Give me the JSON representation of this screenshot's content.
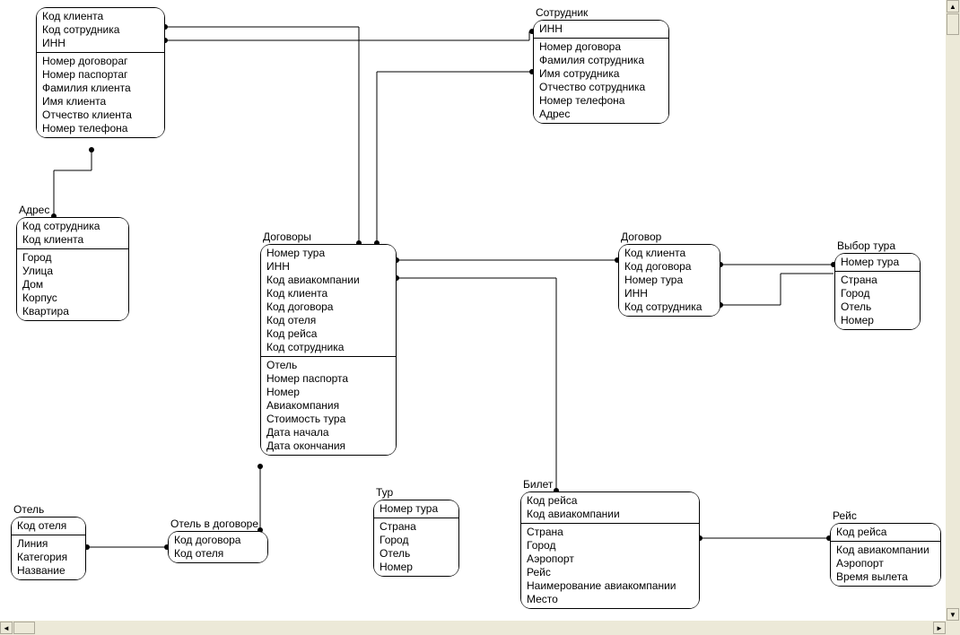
{
  "entities": {
    "client": {
      "title": "",
      "keys": [
        "Код клиента",
        "Код сотрудника",
        "ИНН"
      ],
      "fields": [
        "Номер договораг",
        "Номер паспортаг",
        "Фамилия клиента",
        "Имя клиента",
        "Отчество клиента",
        "Номер телефона"
      ]
    },
    "employee": {
      "title": "Сотрудник",
      "keys": [
        "ИНН"
      ],
      "fields": [
        "Номер договора",
        "Фамилия сотрудника",
        "Имя сотрудника",
        "Отчество сотрудника",
        "Номер телефона",
        "Адрес"
      ]
    },
    "address": {
      "title": "Адрес",
      "keys": [
        "Код сотрудника",
        "Код клиента"
      ],
      "fields": [
        "Город",
        "Улица",
        "Дом",
        "Корпус",
        "Квартира"
      ]
    },
    "contracts": {
      "title": "Договоры",
      "keys": [
        "Номер тура",
        "ИНН",
        "Код авиакомпании",
        "Код клиента",
        "Код договора",
        "Код отеля",
        "Код рейса",
        "Код сотрудника"
      ],
      "fields": [
        "Отель",
        "Номер паспорта",
        "Номер",
        "Авиакомпания",
        "Стоимость тура",
        "Дата начала",
        "Дата окончания"
      ]
    },
    "contract": {
      "title": "Договор",
      "keys": [
        "Код клиента",
        "Код договора",
        "Номер тура",
        "ИНН",
        "Код сотрудника"
      ],
      "fields": []
    },
    "tour_choice": {
      "title": "Выбор тура",
      "keys": [
        "Номер тура"
      ],
      "fields": [
        "Страна",
        "Город",
        "Отель",
        "Номер"
      ]
    },
    "hotel": {
      "title": "Отель",
      "keys": [
        "Код отеля"
      ],
      "fields": [
        "Линия",
        "Категория",
        "Название"
      ]
    },
    "hotel_in_contract": {
      "title": "Отель в договоре",
      "keys": [
        "Код договора",
        "Код отеля"
      ],
      "fields": []
    },
    "tour": {
      "title": "Тур",
      "keys": [
        "Номер тура"
      ],
      "fields": [
        "Страна",
        "Город",
        "Отель",
        "Номер"
      ]
    },
    "ticket": {
      "title": "Билет",
      "keys": [
        "Код рейса",
        "Код авиакомпании"
      ],
      "fields": [
        "Страна",
        "Город",
        "Аэропорт",
        "Рейс",
        "Наимерование авиакомпании",
        "Место"
      ]
    },
    "flight": {
      "title": "Рейс",
      "keys": [
        "Код рейса"
      ],
      "fields": [
        "Код авиакомпании",
        "Аэропорт",
        "Время вылета"
      ]
    }
  }
}
